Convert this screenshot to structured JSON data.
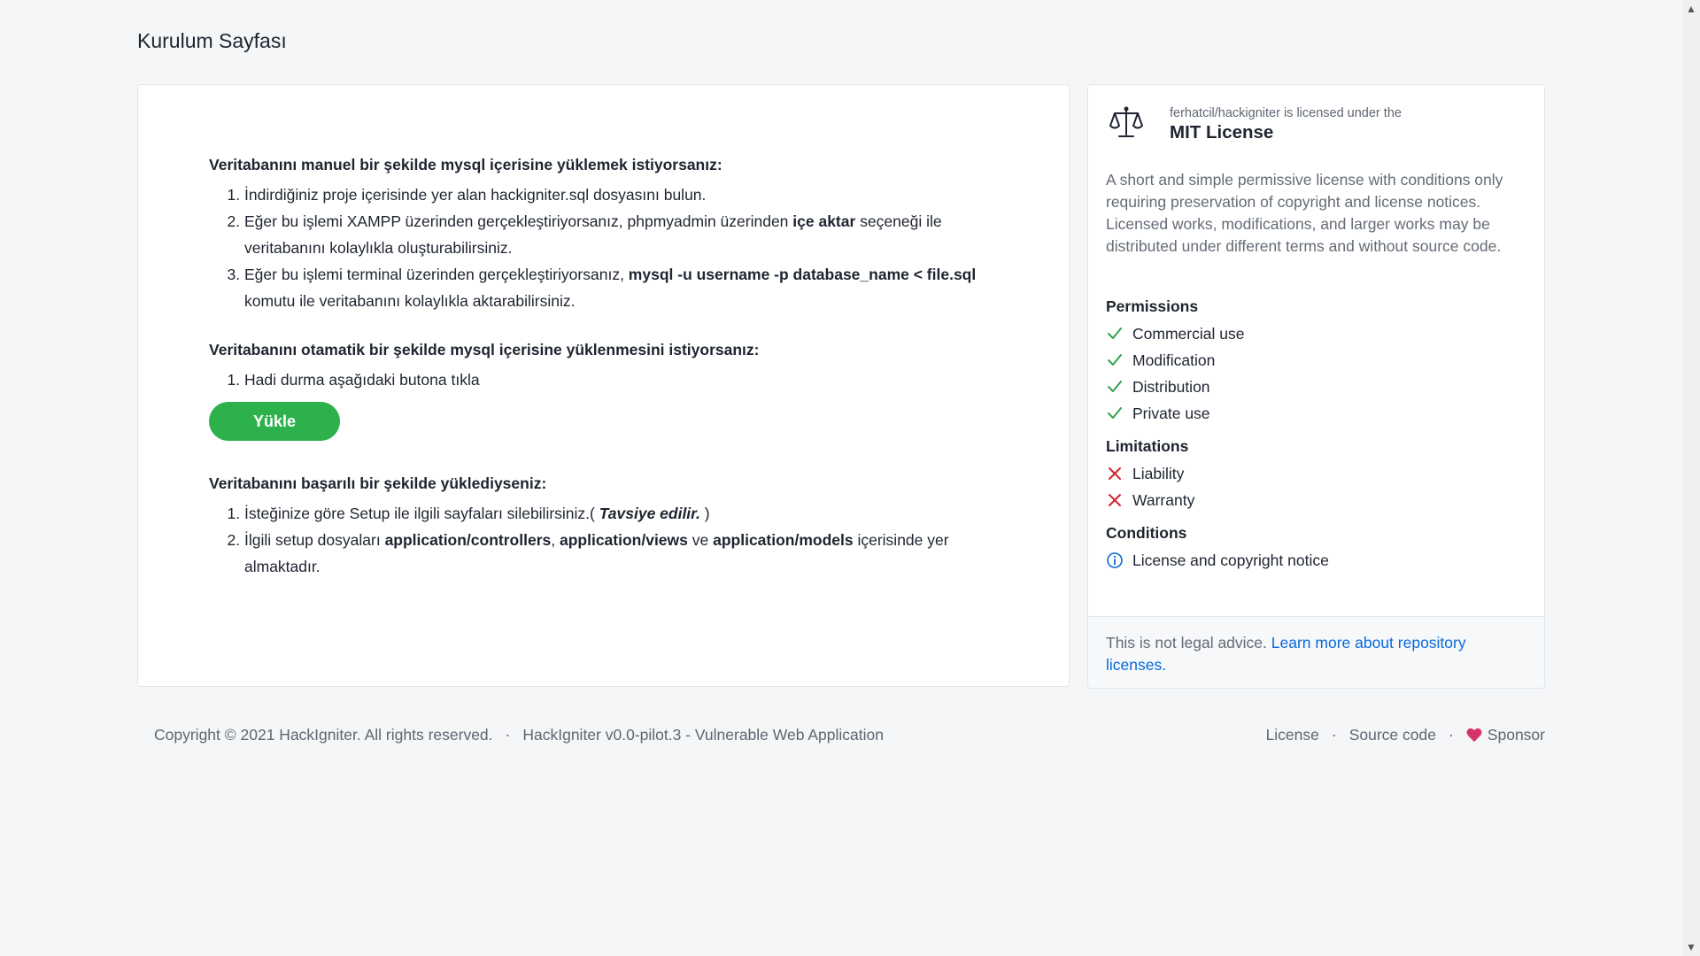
{
  "page": {
    "title": "Kurulum Sayfası"
  },
  "setup": {
    "manual_heading": "Veritabanını manuel bir şekilde mysql içerisine yüklemek istiyorsanız:",
    "manual_step1": "İndirdiğiniz proje içerisinde yer alan hackigniter.sql dosyasını bulun.",
    "manual_step2_a": "Eğer bu işlemi XAMPP üzerinden gerçekleştiriyorsanız, phpmyadmin üzerinden ",
    "manual_step2_b": "içe aktar",
    "manual_step2_c": " seçeneği ile veritabanını kolaylıkla oluşturabilirsiniz.",
    "manual_step3_a": "Eğer bu işlemi terminal üzerinden gerçekleştiriyorsanız, ",
    "manual_step3_b": "mysql -u username -p database_name < file.sql",
    "manual_step3_c": " komutu ile veritabanını kolaylıkla aktarabilirsiniz.",
    "auto_heading": "Veritabanını otamatik bir şekilde mysql içerisine yüklenmesini istiyorsanız:",
    "auto_step1": "Hadi durma aşağıdaki butona tıkla",
    "load_button": "Yükle",
    "done_heading": "Veritabanını başarılı bir şekilde yüklediyseniz:",
    "done_step1_a": "İsteğinize göre Setup ile ilgili sayfaları silebilirsiniz.( ",
    "done_step1_b": "Tavsiye edilir.",
    "done_step1_c": " )",
    "done_step2_a": "İlgili setup dosyaları ",
    "done_step2_b": "application/controllers",
    "done_step2_c": ", ",
    "done_step2_d": "application/views",
    "done_step2_e": " ve ",
    "done_step2_f": "application/models",
    "done_step2_g": " içerisinde yer almaktadır."
  },
  "license": {
    "subtitle": "ferhatcil/hackigniter is licensed under the",
    "title": "MIT License",
    "description": "A short and simple permissive license with conditions only requiring preservation of copyright and license notices. Licensed works, modifications, and larger works may be distributed under different terms and without source code.",
    "permissions_title": "Permissions",
    "permissions": [
      "Commercial use",
      "Modification",
      "Distribution",
      "Private use"
    ],
    "limitations_title": "Limitations",
    "limitations": [
      "Liability",
      "Warranty"
    ],
    "conditions_title": "Conditions",
    "conditions": [
      "License and copyright notice"
    ],
    "footer_text": "This is not legal advice. ",
    "footer_link": "Learn more about repository licenses.",
    "colors": {
      "check": "#2da44e",
      "cross": "#cf222e",
      "info": "#0969da"
    }
  },
  "footer": {
    "copyright": "Copyright © 2021 HackIgniter. All rights reserved.",
    "separator": "·",
    "version": "HackIgniter v0.0-pilot.3 - Vulnerable Web Application",
    "license_link": "License",
    "source_link": "Source code",
    "sponsor_link": "Sponsor",
    "sponsor_color": "#d6336c"
  },
  "icons": [
    "scale-icon",
    "check-icon",
    "x-icon",
    "info-icon",
    "heart-icon"
  ]
}
